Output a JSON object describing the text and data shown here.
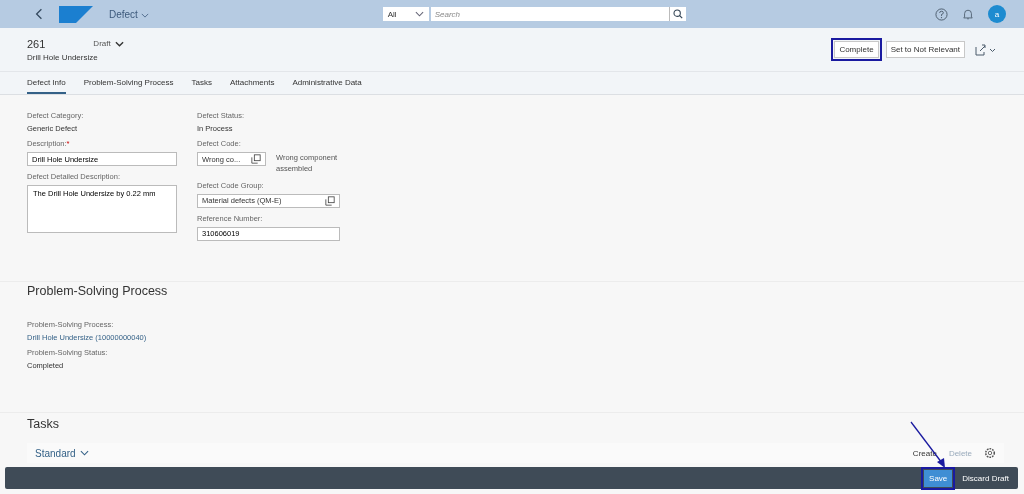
{
  "shell": {
    "app_title": "Defect",
    "search_scope": "All",
    "search_placeholder": "Search",
    "avatar": "a"
  },
  "header": {
    "id": "261",
    "subtitle": "Drill Hole Undersize",
    "status": "Draft",
    "actions": [
      {
        "label": "Complete",
        "highlighted": true
      },
      {
        "label": "Set to Not Relevant"
      }
    ]
  },
  "tabs": [
    {
      "label": "Defect Info",
      "selected": true
    },
    {
      "label": "Problem-Solving Process",
      "selected": false
    },
    {
      "label": "Tasks",
      "selected": false
    },
    {
      "label": "Attachments",
      "selected": false
    },
    {
      "label": "Administrative Data",
      "selected": false
    }
  ],
  "defect_info": {
    "required_mark": "*",
    "left": [
      {
        "kind": "text",
        "label": "Defect Category:",
        "value": "Generic Defect"
      },
      {
        "kind": "input",
        "label": "Description:",
        "required": true,
        "value": "Drill Hole Undersize"
      },
      {
        "kind": "textarea",
        "label": "Defect Detailed Description:",
        "value": "The Drill Hole Undersize by 0.22 mm"
      }
    ],
    "right": [
      {
        "kind": "text",
        "label": "Defect Status:",
        "value": "In Process"
      },
      {
        "kind": "valuehelp",
        "label": "Defect Code:",
        "value": "Wrong co...",
        "description": "Wrong component assembled"
      },
      {
        "kind": "valuehelp",
        "label": "Defect Code Group:",
        "value": "Material defects (QM-E)"
      },
      {
        "kind": "input",
        "label": "Reference Number:",
        "value": "310606019"
      }
    ]
  },
  "problem_solving": {
    "title": "Problem-Solving Process",
    "fields": [
      {
        "kind": "link",
        "label": "Problem-Solving Process:",
        "value": "Drill Hole Undersize (10000000040)"
      },
      {
        "kind": "text",
        "label": "Problem-Solving Status:",
        "value": "Completed"
      }
    ]
  },
  "tasks": {
    "title": "Tasks",
    "variant": "Standard",
    "toolbar": [
      {
        "label": "Create",
        "disabled": false
      },
      {
        "label": "Delete",
        "disabled": true
      }
    ]
  },
  "footer": {
    "actions": [
      {
        "label": "Save",
        "kind": "emphasized",
        "highlighted": true,
        "pointer_arrow": true
      },
      {
        "label": "Discard Draft",
        "kind": "plain"
      }
    ]
  }
}
